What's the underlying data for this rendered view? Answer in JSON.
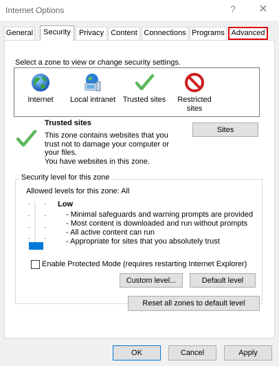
{
  "window": {
    "title": "Internet Options",
    "help_glyph": "?",
    "close_glyph": "✕"
  },
  "tabs": [
    {
      "label": "General"
    },
    {
      "label": "Security"
    },
    {
      "label": "Privacy"
    },
    {
      "label": "Content"
    },
    {
      "label": "Connections"
    },
    {
      "label": "Programs"
    },
    {
      "label": "Advanced"
    }
  ],
  "active_tab": "Security",
  "highlighted_tab": "Advanced",
  "security": {
    "zone_prompt": "Select a zone to view or change security settings.",
    "zones": [
      {
        "label": "Internet",
        "icon": "globe-icon"
      },
      {
        "label": "Local intranet",
        "icon": "network-icon"
      },
      {
        "label": "Trusted sites",
        "icon": "checkmark-icon"
      },
      {
        "label": "Restricted sites",
        "icon": "no-entry-icon"
      }
    ],
    "selected_zone": "Trusted sites",
    "zone_title": "Trusted sites",
    "zone_description": [
      "This zone contains websites that you",
      "trust not to damage your computer or",
      "your files.",
      "You have websites in this zone."
    ],
    "sites_button": "Sites",
    "level_group_label": "Security level for this zone",
    "allowed_levels": "Allowed levels for this zone: All",
    "level_name": "Low",
    "level_details": [
      "- Minimal safeguards and warning prompts are provided",
      "- Most content is downloaded and run without prompts",
      "- All active content can run",
      "- Appropriate for sites that you absolutely trust"
    ],
    "slider_level_fraction": 0.0,
    "protected_mode_label": "Enable Protected Mode (requires restarting Internet Explorer)",
    "protected_mode_checked": false,
    "custom_level_button": "Custom level...",
    "default_level_button": "Default level",
    "reset_all_button": "Reset all zones to default level"
  },
  "footer": {
    "ok": "OK",
    "cancel": "Cancel",
    "apply": "Apply"
  },
  "colors": {
    "accent": "#0078d7",
    "highlight_border": "#e0000b",
    "check_green": "#5cb85c",
    "restricted_red": "#cc1f1f"
  }
}
